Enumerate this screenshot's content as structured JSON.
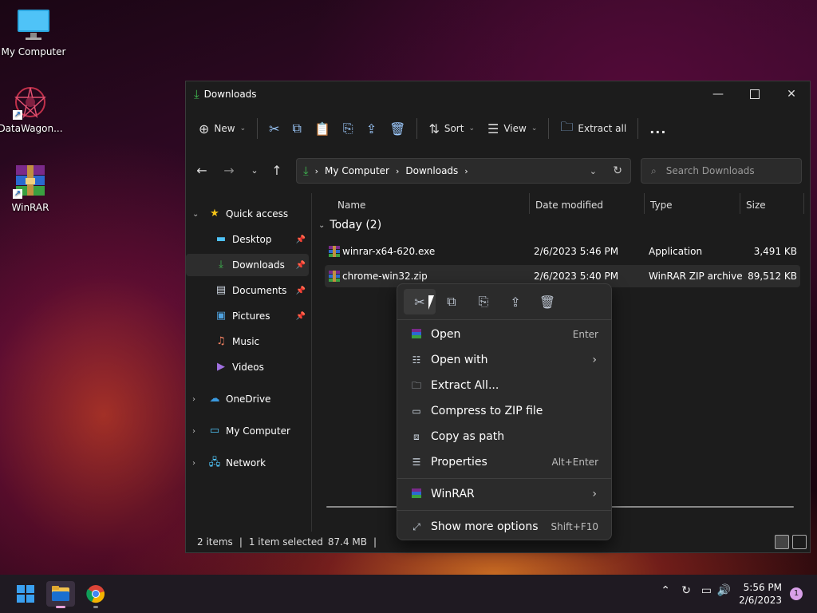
{
  "desktop": {
    "icons": [
      {
        "label": "My Computer"
      },
      {
        "label": "DataWagon..."
      },
      {
        "label": "WinRAR"
      }
    ]
  },
  "window": {
    "title": "Downloads",
    "accent": "#3fb950"
  },
  "toolbar": {
    "new_label": "New",
    "sort_label": "Sort",
    "view_label": "View",
    "extract_label": "Extract all",
    "more_label": "..."
  },
  "address": {
    "crumbs": [
      "My Computer",
      "Downloads"
    ],
    "search_placeholder": "Search Downloads"
  },
  "sidebar": {
    "quick_access": "Quick access",
    "items": [
      {
        "label": "Desktop"
      },
      {
        "label": "Downloads"
      },
      {
        "label": "Documents"
      },
      {
        "label": "Pictures"
      },
      {
        "label": "Music"
      },
      {
        "label": "Videos"
      }
    ],
    "onedrive": "OneDrive",
    "my_computer": "My Computer",
    "network": "Network"
  },
  "columns": {
    "name": "Name",
    "date": "Date modified",
    "type": "Type",
    "size": "Size"
  },
  "group_label": "Today (2)",
  "files": [
    {
      "name": "winrar-x64-620.exe",
      "date": "2/6/2023 5:46 PM",
      "type": "Application",
      "size": "3,491 KB"
    },
    {
      "name": "chrome-win32.zip",
      "date": "2/6/2023 5:40 PM",
      "type": "WinRAR ZIP archive",
      "size": "89,512 KB"
    }
  ],
  "status": {
    "items": "2 items",
    "selected": "1 item selected",
    "size": "87.4 MB"
  },
  "context_menu": {
    "items": [
      {
        "label": "Open",
        "shortcut": "Enter"
      },
      {
        "label": "Open with",
        "shortcut": ""
      },
      {
        "label": "Extract All...",
        "shortcut": ""
      },
      {
        "label": "Compress to ZIP file",
        "shortcut": ""
      },
      {
        "label": "Copy as path",
        "shortcut": ""
      },
      {
        "label": "Properties",
        "shortcut": "Alt+Enter"
      },
      {
        "label": "WinRAR",
        "shortcut": ""
      },
      {
        "label": "Show more options",
        "shortcut": "Shift+F10"
      }
    ]
  },
  "taskbar": {
    "time": "5:56 PM",
    "date": "2/6/2023",
    "notifications": "1"
  }
}
